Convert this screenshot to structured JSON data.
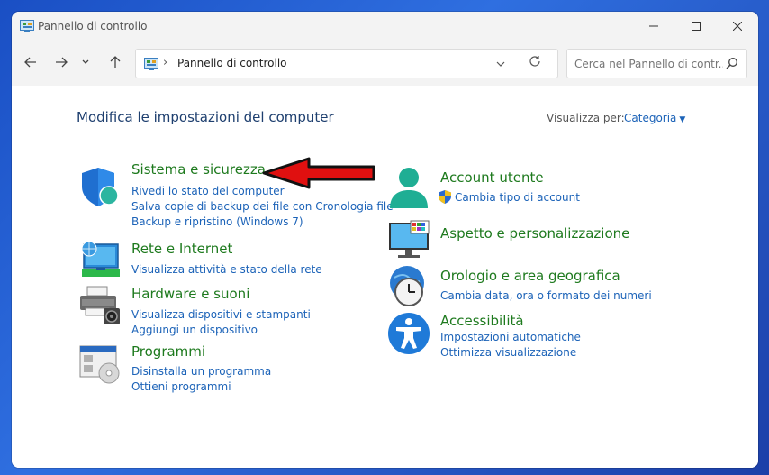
{
  "window": {
    "title": "Pannello di controllo"
  },
  "address": {
    "path": "Pannello di controllo"
  },
  "search": {
    "placeholder": "Cerca nel Pannello di contr..."
  },
  "main": {
    "heading": "Modifica le impostazioni del computer",
    "view_by_label": "Visualizza per:",
    "view_by_value": "Categoria"
  },
  "categories_left": [
    {
      "title": "Sistema e sicurezza",
      "links": [
        "Rivedi lo stato del computer",
        "Salva copie di backup dei file con Cronologia file",
        "Backup e ripristino (Windows 7)"
      ],
      "icon": "shield-icon"
    },
    {
      "title": "Rete e Internet",
      "links": [
        "Visualizza attività e stato della rete"
      ],
      "icon": "network-icon"
    },
    {
      "title": "Hardware e suoni",
      "links": [
        "Visualizza dispositivi e stampanti",
        "Aggiungi un dispositivo"
      ],
      "icon": "printer-icon"
    },
    {
      "title": "Programmi",
      "links": [
        "Disinstalla un programma",
        "Ottieni programmi"
      ],
      "icon": "programs-icon"
    }
  ],
  "categories_right": [
    {
      "title": "Account utente",
      "links": [
        "Cambia tipo di account"
      ],
      "icon": "user-icon"
    },
    {
      "title": "Aspetto e personalizzazione",
      "links": [],
      "icon": "display-icon"
    },
    {
      "title": "Orologio e area geografica",
      "links": [
        "Cambia data, ora o formato dei numeri"
      ],
      "icon": "clock-icon"
    },
    {
      "title": "Accessibilità",
      "links": [
        "Impostazioni automatiche",
        "Ottimizza visualizzazione"
      ],
      "icon": "accessibility-icon"
    }
  ],
  "colors": {
    "category_title": "#1e7a1e",
    "link": "#1c63b8",
    "heading": "#1e3f6f",
    "annotation_arrow": "#e01010"
  }
}
